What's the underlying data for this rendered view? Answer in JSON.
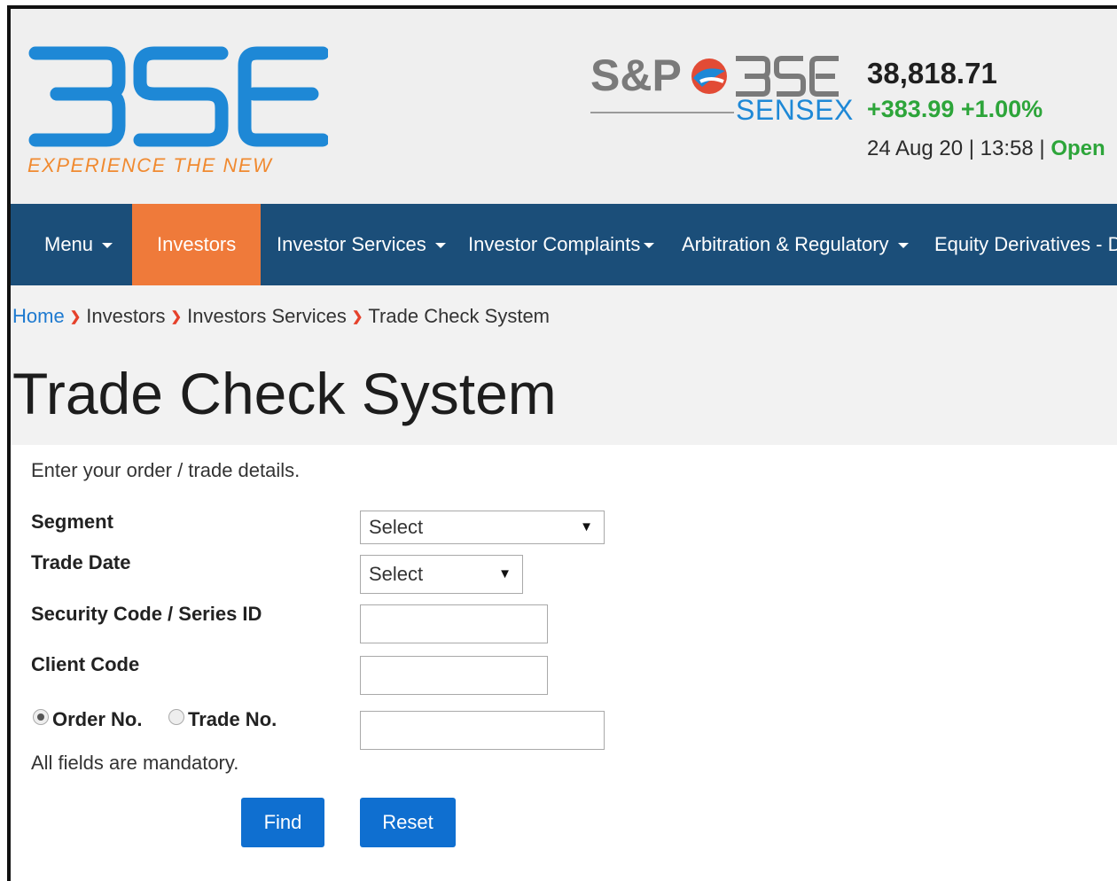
{
  "header": {
    "logo_text": "BSE",
    "logo_tagline": "EXPERIENCE THE NEW",
    "sp_logo_text": "S&P BSE",
    "index_name": "SENSEX",
    "index_value": "38,818.71",
    "index_change": "+383.99 +1.00%",
    "datetime": "24 Aug 20 | 13:58 |",
    "market_status": "Open"
  },
  "colors": {
    "brand_blue": "#1e88d6",
    "nav_bg": "#1b4e79",
    "active_tab": "#ef7a3a",
    "positive_green": "#2da53a",
    "button_blue": "#0f6fd0",
    "tagline_orange": "#f08a30"
  },
  "nav": {
    "menu": "Menu",
    "investors": "Investors",
    "investor_services": "Investor Services",
    "investor_complaints": "Investor Complaints",
    "arbitration": "Arbitration & Regulatory",
    "equity_derivatives": "Equity Derivatives - D"
  },
  "breadcrumb": [
    "Home",
    "Investors",
    "Investors Services",
    "Trade Check System"
  ],
  "page_title": "Trade Check System",
  "form": {
    "intro": "Enter your order / trade details.",
    "segment_label": "Segment",
    "segment_value": "Select",
    "trade_date_label": "Trade Date",
    "trade_date_value": "Select",
    "security_code_label": "Security Code / Series ID",
    "security_code_value": "",
    "client_code_label": "Client Code",
    "client_code_value": "",
    "order_no_label": "Order No.",
    "trade_no_label": "Trade No.",
    "selected_option": "Order No.",
    "number_value": "",
    "mandatory_note": "All fields are mandatory.",
    "find_label": "Find",
    "reset_label": "Reset"
  }
}
